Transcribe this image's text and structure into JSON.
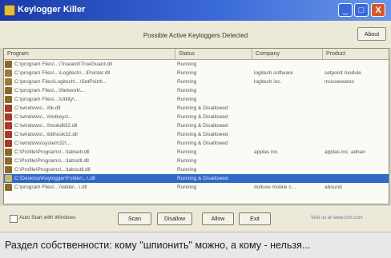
{
  "window": {
    "title": "Keylogger Killer"
  },
  "titlebar_buttons": {
    "min": "_",
    "max": "□",
    "close": "X"
  },
  "header": {
    "heading": "Possible Active Keyloggers Detected",
    "about_label": "About"
  },
  "table": {
    "columns": [
      "Program",
      "Status",
      "Company",
      "Product"
    ],
    "rows": [
      {
        "program": "C:\\program Files\\...\\Trueanti\\TrueGuard.dll",
        "status": "Running",
        "company": "",
        "product": "",
        "icon_color": "#8a6a2a"
      },
      {
        "program": "C:\\program Files\\...\\Logitech\\...\\Pointer.dll",
        "status": "Running",
        "company": "logitech software",
        "product": "setpoint module",
        "icon_color": "#9a7a3a"
      },
      {
        "program": "C:\\program Files\\Logitech\\...\\SetPoint\\...",
        "status": "Running",
        "company": "logitech inc.",
        "product": "mousewares",
        "icon_color": "#9a7a3a"
      },
      {
        "program": "C:\\program Files\\...\\Network\\...",
        "status": "Running",
        "company": "",
        "product": "",
        "icon_color": "#8a6a2a"
      },
      {
        "program": "C:\\program Files\\...\\Utility\\...",
        "status": "Running",
        "company": "",
        "product": "",
        "icon_color": "#8a6a2a"
      },
      {
        "program": "C:\\windows\\...\\hk.dll",
        "status": "Running & Disallowed",
        "company": "",
        "product": "",
        "icon_color": "#a83a2a"
      },
      {
        "program": "C:\\windows\\...\\Hotkeys\\...",
        "status": "Running & Disallowed",
        "company": "",
        "product": "",
        "icon_color": "#a83a2a"
      },
      {
        "program": "C:\\windows\\...\\hookdll32.dll",
        "status": "Running & Disallowed",
        "company": "",
        "product": "",
        "icon_color": "#a83a2a"
      },
      {
        "program": "C:\\windows\\...\\kbhook32.dll",
        "status": "Running & Disallowed",
        "company": "",
        "product": "",
        "icon_color": "#a83a2a"
      },
      {
        "program": "C:\\windows\\system32\\...",
        "status": "Running & Disallowed",
        "company": "",
        "product": "",
        "icon_color": "#a83a2a"
      },
      {
        "program": "C:\\Profile\\Programs\\...\\tabsetr.dll",
        "status": "Running",
        "company": "applas inc.",
        "product": "applas inc. adnan",
        "icon_color": "#8a6a2a"
      },
      {
        "program": "C:\\Profile\\Programs\\...\\tabsdll.dll",
        "status": "Running",
        "company": "",
        "product": "",
        "icon_color": "#8a6a2a"
      },
      {
        "program": "C:\\Profile\\Programs\\...\\tabsutil.dll",
        "status": "Running",
        "company": "",
        "product": "",
        "icon_color": "#8a6a2a"
      },
      {
        "program": "C:\\Desktop\\Keylogger\\Folder\\...\\.dll",
        "status": "Running & Disallowed",
        "company": "",
        "product": "",
        "icon_color": "#c8b870",
        "selected": true
      },
      {
        "program": "C:\\program Files\\...\\Valde\\...\\.dll",
        "status": "Running",
        "company": "dolluxe mobile c...",
        "product": "abound",
        "icon_color": "#8a6a2a"
      }
    ]
  },
  "bottom": {
    "checkbox_label": "Auto Start with Windows",
    "buttons": [
      "Scan",
      "Disallow",
      "Allow",
      "Exit"
    ],
    "link_text": "Visit us at www.tsm.com"
  },
  "caption": "Раздел собственности: кому \"шпионить\" можно, а кому - нельзя..."
}
